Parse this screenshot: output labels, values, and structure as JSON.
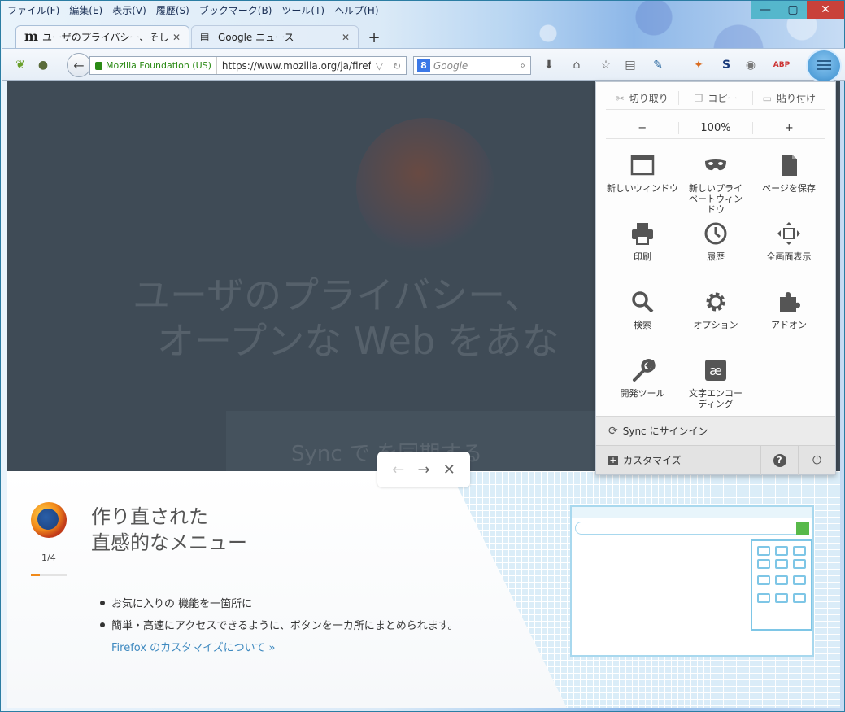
{
  "menubar": [
    "ファイル(F)",
    "編集(E)",
    "表示(V)",
    "履歴(S)",
    "ブックマーク(B)",
    "ツール(T)",
    "ヘルプ(H)"
  ],
  "window_controls": {
    "minimize": "—",
    "maximize": "▢",
    "close": "✕"
  },
  "tabs": [
    {
      "favicon": "m",
      "title": "ユーザのプライバシー、そしてオ...",
      "close": "✕",
      "active": true
    },
    {
      "favicon": "📰",
      "title": "Google ニュース",
      "close": "✕",
      "active": false
    }
  ],
  "new_tab": "+",
  "urlbar": {
    "identity": "Mozilla Foundation (US)",
    "url": "https://www.mozilla.org/ja/firef",
    "dropdown": "▽",
    "reload": "↻"
  },
  "searchbar": {
    "engine": "8",
    "placeholder": "Google",
    "go": "⌕"
  },
  "content": {
    "hero_title_line1": "ユーザのプライバシー、",
    "hero_title_line2": "オープンな Web をあな",
    "sync_banner": "Sync で    を同期する"
  },
  "tour": {
    "count": "1/4",
    "progress": 0.25,
    "title_line1": "作り直された",
    "title_line2": "直感的なメニュー",
    "bullets": [
      "お気に入りの 機能を一箇所に",
      "簡単・高速にアクセスできるように、ボタンを一カ所にまとめられます。"
    ],
    "link": "Firefox のカスタマイズについて",
    "link_arrow": "»",
    "nav": {
      "prev": "←",
      "next": "→",
      "close": "✕"
    }
  },
  "panel": {
    "edit": {
      "cut": "切り取り",
      "copy": "コピー",
      "paste": "貼り付け"
    },
    "zoom": {
      "out": "−",
      "level": "100%",
      "in": "+"
    },
    "items": [
      {
        "name": "new-window",
        "label": "新しいウィンドウ"
      },
      {
        "name": "new-private-window",
        "label": "新しいプライベートウィンドウ"
      },
      {
        "name": "save-page",
        "label": "ページを保存"
      },
      {
        "name": "print",
        "label": "印刷"
      },
      {
        "name": "history",
        "label": "履歴"
      },
      {
        "name": "fullscreen",
        "label": "全画面表示"
      },
      {
        "name": "find",
        "label": "検索"
      },
      {
        "name": "options",
        "label": "オプション"
      },
      {
        "name": "addons",
        "label": "アドオン"
      },
      {
        "name": "developer",
        "label": "開発ツール"
      },
      {
        "name": "character-encoding",
        "label": "文字エンコーディング"
      }
    ],
    "sync": "Sync にサインイン",
    "customize": "カスタマイズ",
    "help": "?",
    "quit": "⏻"
  }
}
